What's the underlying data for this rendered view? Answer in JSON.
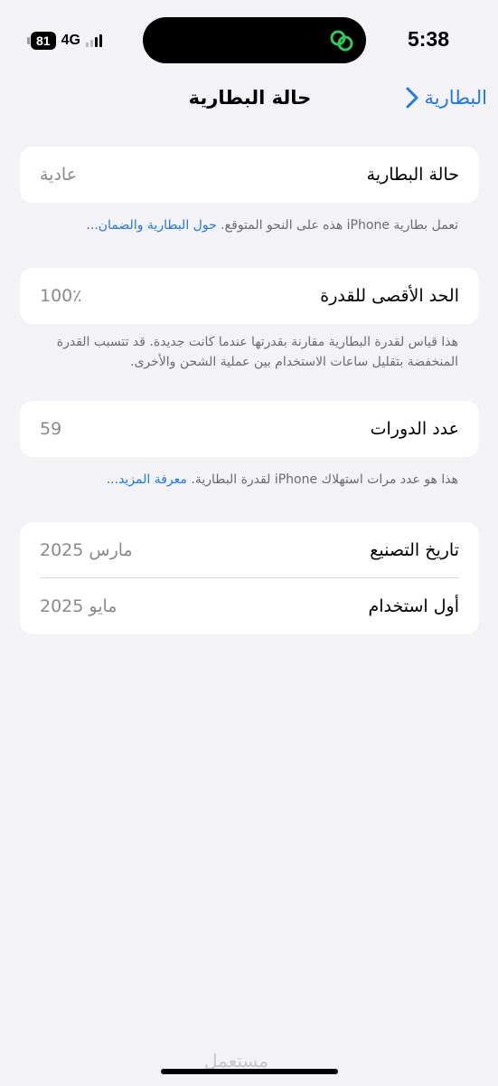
{
  "status_bar": {
    "time": "5:38",
    "battery_level": "81",
    "network": "4G",
    "signal_bars_active": 2,
    "signal_bars_total": 4,
    "island_icon": "link-rings-icon",
    "island_icon_color": "#35c759"
  },
  "nav": {
    "back_label": "البطارية",
    "title": "حالة البطارية"
  },
  "sections": {
    "health": {
      "label": "حالة البطارية",
      "value": "عادية",
      "footnote_text": "تعمل بطارية iPhone هذه على النحو المتوقع. ",
      "footnote_link": "حول البطارية والضمان..."
    },
    "capacity": {
      "label": "الحد الأقصى للقدرة",
      "value": "100٪",
      "footnote_text": "هذا قياس لقدرة البطارية مقارنة بقدرتها عندما كانت جديدة. قد تتسبب القدرة المنخفضة بتقليل ساعات الاستخدام بين عملية الشحن والأخرى."
    },
    "cycles": {
      "label": "عدد الدورات",
      "value": "59",
      "footnote_text": "هذا هو عدد مرات استهلاك iPhone لقدرة البطارية. ",
      "footnote_link": "معرفة المزيد..."
    },
    "dates": {
      "manufacture_label": "تاريخ التصنيع",
      "manufacture_value": "مارس 2025",
      "first_use_label": "أول استخدام",
      "first_use_value": "مايو 2025"
    }
  },
  "watermark": "مستعمل",
  "colors": {
    "accent": "#1f7ae0",
    "background": "#f2f2f7",
    "secondary_text": "#8a8a8e"
  }
}
